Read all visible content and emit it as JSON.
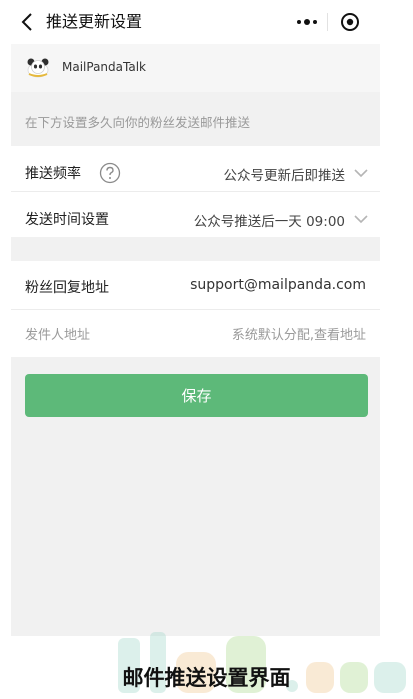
{
  "header": {
    "title": "推送更新设置",
    "icons": {
      "back": "back-arrow-icon",
      "more": "more-dots-icon",
      "close": "target-circle-icon"
    }
  },
  "account": {
    "name": "MailPandaTalk",
    "logo_icon": "panda-logo-icon"
  },
  "hint": "在下方设置多久向你的粉丝发送邮件推送",
  "settings": {
    "frequency": {
      "label": "推送频率",
      "value": "公众号更新后即推送"
    },
    "send_time": {
      "label": "发送时间设置",
      "value": "公众号推送后一天 09:00"
    },
    "reply_address": {
      "label": "粉丝回复地址",
      "value": "support@mailpanda.com"
    },
    "sender_address": {
      "label": "发件人地址",
      "value": "系统默认分配,查看地址"
    }
  },
  "save_label": "保存",
  "caption": "邮件推送设置界面",
  "colors": {
    "accent": "#5db979",
    "panel": "#f1f1f1"
  }
}
